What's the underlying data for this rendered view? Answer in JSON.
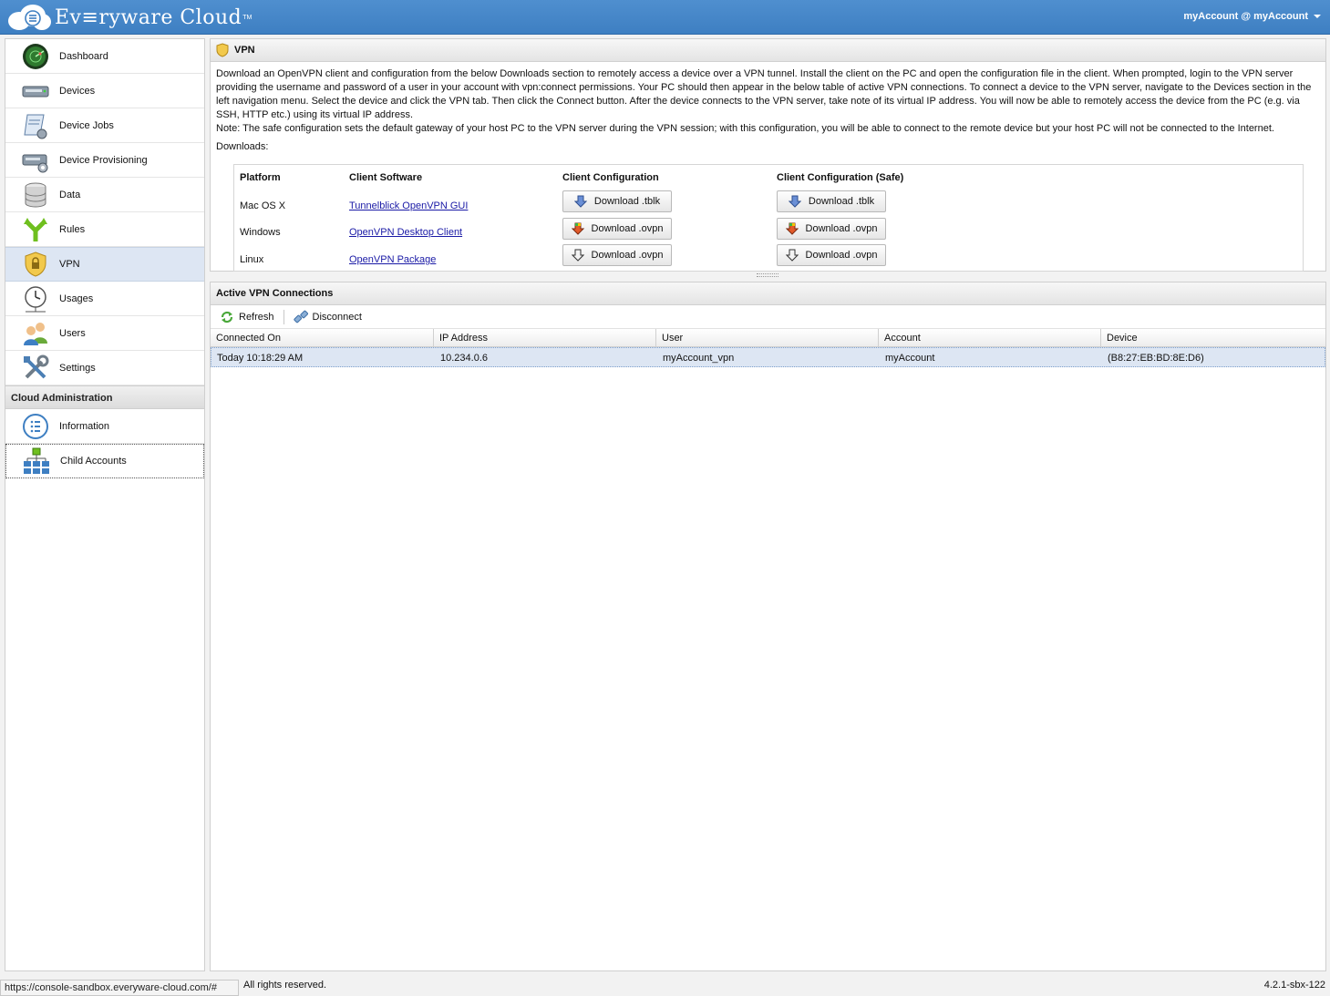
{
  "header": {
    "logo_text": "Ev≡ryware Cloud",
    "logo_tm": "TM",
    "account_label": "myAccount @ myAccount"
  },
  "sidebar": {
    "items": [
      {
        "label": "Dashboard",
        "icon": "dashboard-radar-icon"
      },
      {
        "label": "Devices",
        "icon": "device-icon"
      },
      {
        "label": "Device Jobs",
        "icon": "device-jobs-icon"
      },
      {
        "label": "Device Provisioning",
        "icon": "device-provisioning-icon"
      },
      {
        "label": "Data",
        "icon": "database-icon"
      },
      {
        "label": "Rules",
        "icon": "rules-fork-icon"
      },
      {
        "label": "VPN",
        "icon": "vpn-shield-icon"
      },
      {
        "label": "Usages",
        "icon": "usages-gauge-icon"
      },
      {
        "label": "Users",
        "icon": "users-icon"
      },
      {
        "label": "Settings",
        "icon": "settings-tools-icon"
      }
    ],
    "section_title": "Cloud Administration",
    "admin_items": [
      {
        "label": "Information",
        "icon": "information-icon"
      },
      {
        "label": "Child Accounts",
        "icon": "child-accounts-icon"
      }
    ]
  },
  "vpn": {
    "title": "VPN",
    "description": "Download an OpenVPN client and configuration from the below Downloads section to remotely access a device over a VPN tunnel. Install the client on the PC and open the configuration file in the client. When prompted, login to the VPN server providing the username and password of a user in your account with vpn:connect permissions. Your PC should then appear in the below table of active VPN connections. To connect a device to the VPN server, navigate to the Devices section in the left navigation menu. Select the device and click the VPN tab. Then click the Connect button. After the device connects to the VPN server, take note of its virtual IP address. You will now be able to remotely access the device from the PC (e.g. via SSH, HTTP etc.) using its virtual IP address.",
    "note": "Note: The safe configuration sets the default gateway of your host PC to the VPN server during the VPN session; with this configuration, you will be able to connect to the remote device but your host PC will not be connected to the Internet.",
    "downloads_label": "Downloads:",
    "columns": [
      "Platform",
      "Client Software",
      "Client Configuration",
      "Client Configuration (Safe)"
    ],
    "rows": [
      {
        "platform": "Mac OS X",
        "software": "Tunnelblick OpenVPN GUI",
        "config": "Download .tblk",
        "safe": "Download .tblk"
      },
      {
        "platform": "Windows",
        "software": "OpenVPN Desktop Client",
        "config": "Download .ovpn",
        "safe": "Download .ovpn"
      },
      {
        "platform": "Linux",
        "software": "OpenVPN Package",
        "config": "Download .ovpn",
        "safe": "Download .ovpn"
      }
    ]
  },
  "connections": {
    "title": "Active VPN Connections",
    "refresh_label": "Refresh",
    "disconnect_label": "Disconnect",
    "columns": [
      "Connected On",
      "IP Address",
      "User",
      "Account",
      "Device"
    ],
    "rows": [
      {
        "connected_on": "Today 10:18:29 AM",
        "ip": "10.234.0.6",
        "user": "myAccount_vpn",
        "account": "myAccount",
        "device": "(B8:27:EB:BD:8E:D6)"
      }
    ]
  },
  "status": {
    "url": "https://console-sandbox.everyware-cloud.com/#",
    "rights": "All rights reserved.",
    "version": "4.2.1-sbx-122"
  },
  "colors": {
    "header_blue": "#4a8ccc",
    "selected_row": "#dde6f3",
    "link": "#1a1aa6"
  }
}
